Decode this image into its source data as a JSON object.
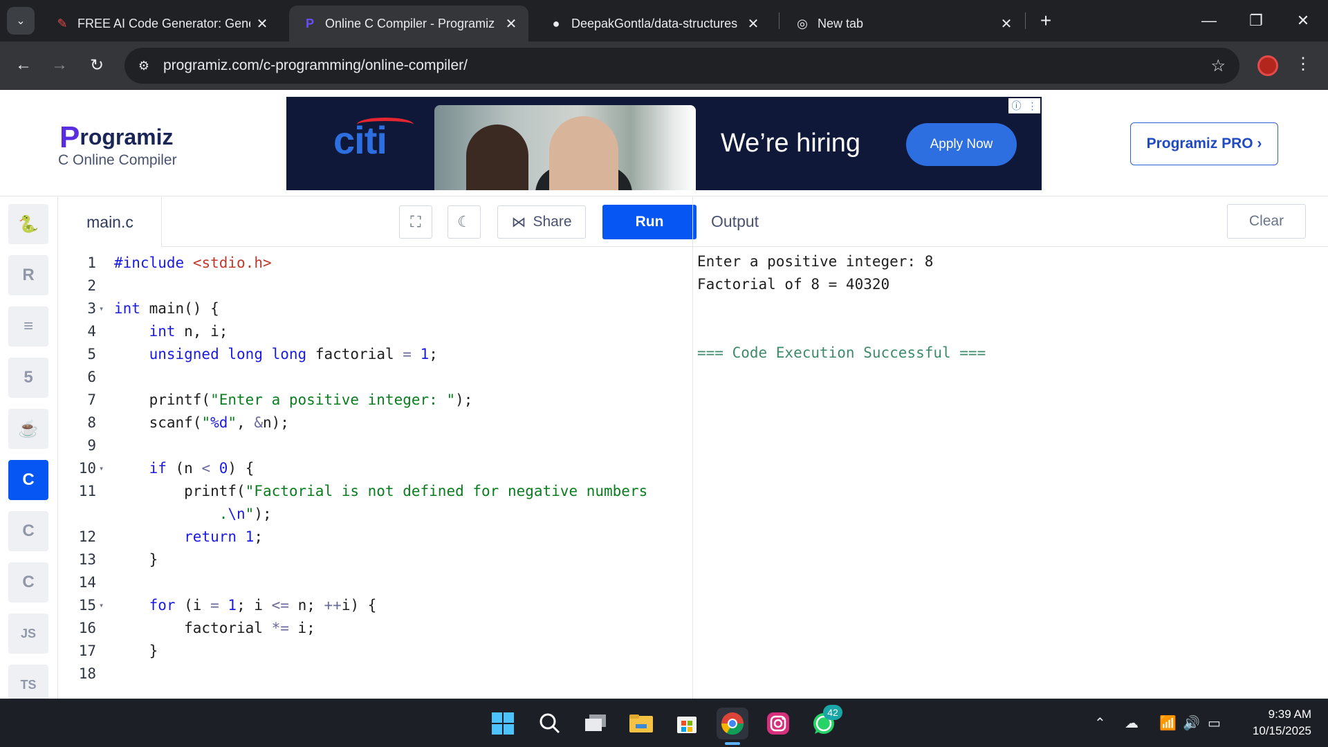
{
  "browser": {
    "tabs": [
      {
        "title": "FREE AI Code Generator: Gener",
        "favicon": "ai-code-icon",
        "active": false
      },
      {
        "title": "Online C Compiler - Programiz",
        "favicon": "programiz-icon",
        "active": true
      },
      {
        "title": "DeepakGontla/data-structures-i",
        "favicon": "github-icon",
        "active": false
      },
      {
        "title": "New tab",
        "favicon": "chrome-icon",
        "active": false
      }
    ],
    "url": "programiz.com/c-programming/online-compiler/"
  },
  "site": {
    "logo_text": "rogramiz",
    "logo_mark": "P",
    "subtitle": "C Online Compiler",
    "pro_button": "Programiz PRO ›"
  },
  "ad": {
    "brand": "citi",
    "headline": "We’re hiring",
    "cta": "Apply Now"
  },
  "languages": [
    {
      "name": "python-icon",
      "glyph": "🐍",
      "active": false
    },
    {
      "name": "r-icon",
      "glyph": "R",
      "active": false
    },
    {
      "name": "sql-icon",
      "glyph": "≡",
      "active": false
    },
    {
      "name": "html5-icon",
      "glyph": "5",
      "active": false
    },
    {
      "name": "java-icon",
      "glyph": "☕",
      "active": false
    },
    {
      "name": "c-icon",
      "glyph": "C",
      "active": true
    },
    {
      "name": "cpp-icon",
      "glyph": "C",
      "active": false
    },
    {
      "name": "csharp-icon",
      "glyph": "C",
      "active": false
    },
    {
      "name": "js-icon",
      "glyph": "JS",
      "active": false
    },
    {
      "name": "ts-icon",
      "glyph": "TS",
      "active": false
    }
  ],
  "editor": {
    "filename": "main.c",
    "share_label": "Share",
    "run_label": "Run",
    "lines": [
      {
        "n": "1",
        "fold": false,
        "html": "<span class=\"k\">#include</span> <span class=\"hdr\">&lt;stdio.h&gt;</span>"
      },
      {
        "n": "2",
        "fold": false,
        "html": ""
      },
      {
        "n": "3",
        "fold": true,
        "html": "<span class=\"k\">int</span> main() {"
      },
      {
        "n": "4",
        "fold": false,
        "html": "    <span class=\"k\">int</span> n, i;"
      },
      {
        "n": "5",
        "fold": false,
        "html": "    <span class=\"k\">unsigned</span> <span class=\"k\">long</span> <span class=\"k\">long</span> factorial <span class=\"op\">=</span> <span class=\"n\">1</span>;"
      },
      {
        "n": "6",
        "fold": false,
        "html": ""
      },
      {
        "n": "7",
        "fold": false,
        "html": "    printf(<span class=\"s\">\"Enter a positive integer: \"</span>);"
      },
      {
        "n": "8",
        "fold": false,
        "html": "    scanf(<span class=\"s\">\"</span><span class=\"n\">%d</span><span class=\"s\">\"</span>, <span class=\"op\">&amp;</span>n);"
      },
      {
        "n": "9",
        "fold": false,
        "html": ""
      },
      {
        "n": "10",
        "fold": true,
        "html": "    <span class=\"k\">if</span> (n <span class=\"op\">&lt;</span> <span class=\"n\">0</span>) {"
      },
      {
        "n": "11",
        "fold": false,
        "html": "        printf(<span class=\"s\">\"Factorial is not defined for negative numbers</span>"
      },
      {
        "n": "",
        "fold": false,
        "html": "            <span class=\"s\">.</span><span class=\"n\">\\n</span><span class=\"s\">\"</span>);"
      },
      {
        "n": "12",
        "fold": false,
        "html": "        <span class=\"k\">return</span> <span class=\"n\">1</span>;"
      },
      {
        "n": "13",
        "fold": false,
        "html": "    }"
      },
      {
        "n": "14",
        "fold": false,
        "html": ""
      },
      {
        "n": "15",
        "fold": true,
        "html": "    <span class=\"k\">for</span> (i <span class=\"op\">=</span> <span class=\"n\">1</span>; i <span class=\"op\">&lt;=</span> n; <span class=\"op\">++</span>i) {"
      },
      {
        "n": "16",
        "fold": false,
        "html": "        factorial <span class=\"op\">*=</span> i;"
      },
      {
        "n": "17",
        "fold": false,
        "html": "    }"
      },
      {
        "n": "18",
        "fold": false,
        "html": ""
      }
    ]
  },
  "output": {
    "title": "Output",
    "clear_label": "Clear",
    "lines": [
      {
        "text": "Enter a positive integer: 8",
        "ok": false
      },
      {
        "text": "Factorial of 8 = 40320",
        "ok": false
      },
      {
        "text": "",
        "ok": false
      },
      {
        "text": "",
        "ok": false
      },
      {
        "text": "=== Code Execution Successful ===",
        "ok": true
      }
    ]
  },
  "taskbar": {
    "badge_count": "42",
    "time": "9:39 AM",
    "date": "10/15/2025"
  },
  "colors": {
    "accent": "#0556f3",
    "chrome_bg": "#202124",
    "taskbar_bg": "#1c1f26"
  }
}
